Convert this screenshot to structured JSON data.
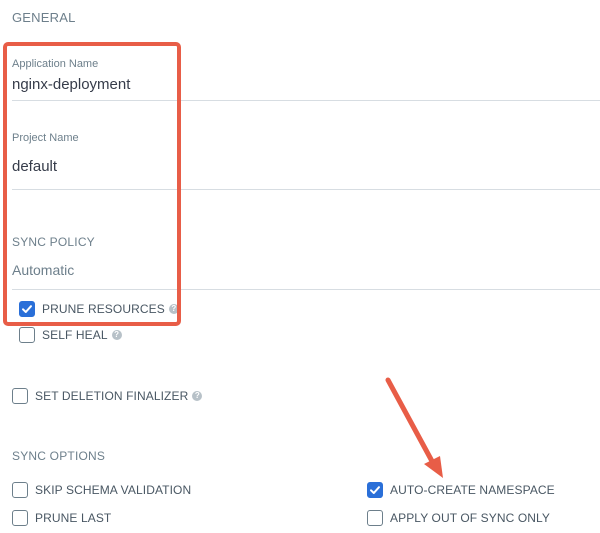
{
  "general": {
    "title": "GENERAL",
    "application_name": {
      "label": "Application Name",
      "value": "nginx-deployment"
    },
    "project_name": {
      "label": "Project Name",
      "value": "default"
    }
  },
  "sync_policy": {
    "label": "SYNC POLICY",
    "value": "Automatic",
    "options": [
      {
        "label": "PRUNE RESOURCES",
        "checked": true,
        "help": "?"
      },
      {
        "label": "SELF HEAL",
        "checked": false,
        "help": "?"
      },
      {
        "label": "SET DELETION FINALIZER",
        "checked": false,
        "help": "?"
      }
    ]
  },
  "sync_options": {
    "title": "SYNC OPTIONS",
    "items": [
      {
        "label": "SKIP SCHEMA VALIDATION",
        "checked": false
      },
      {
        "label": "AUTO-CREATE NAMESPACE",
        "checked": true
      },
      {
        "label": "PRUNE LAST",
        "checked": false
      },
      {
        "label": "APPLY OUT OF SYNC ONLY",
        "checked": false
      }
    ]
  },
  "colors": {
    "annotation": "#e85d47",
    "checkbox_checked": "#2a6fd8"
  }
}
